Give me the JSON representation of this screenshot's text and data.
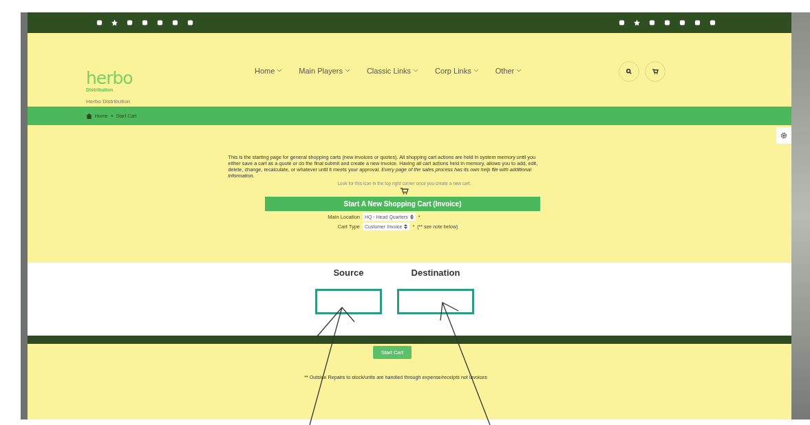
{
  "logo": {
    "name": "herbo",
    "tagline": "Distribution"
  },
  "site_name": "Herbo Distribution",
  "nav": [
    {
      "label": "Home"
    },
    {
      "label": "Main Players"
    },
    {
      "label": "Classic Links"
    },
    {
      "label": "Corp Links"
    },
    {
      "label": "Other"
    }
  ],
  "breadcrumb": {
    "items": [
      "Home",
      "Start Cart"
    ],
    "separator": "»"
  },
  "intro": "This is the starting page for general shopping carts (new invoices or quotes). All shopping cart actions are held in system memory until you either save a cart as a quote or do the final submit and create a new invoice. Having all cart actions held in memory, allows you to add, edit, delete, change, recalculate, or whatever until it meets your approval. *Every page of the sales process has its own help file with additional information.*",
  "hint": "Look for this icon in the top right corner once you create a new cart.",
  "panel_title": "Start A New Shopping Cart (Invoice)",
  "fields": [
    {
      "label": "Main Location",
      "value": "HQ · Head Quarters",
      "required_mark": "*"
    },
    {
      "label": "Cart Type",
      "value": "Customer Invoice",
      "required_mark": "*",
      "note": "(** see note below)"
    }
  ],
  "annotation": {
    "labels": [
      "Source",
      "Destination"
    ]
  },
  "start_button": "Start Cart",
  "footnote": "** Outside Repairs to stock/units are handled through expense/receipts not invoices"
}
